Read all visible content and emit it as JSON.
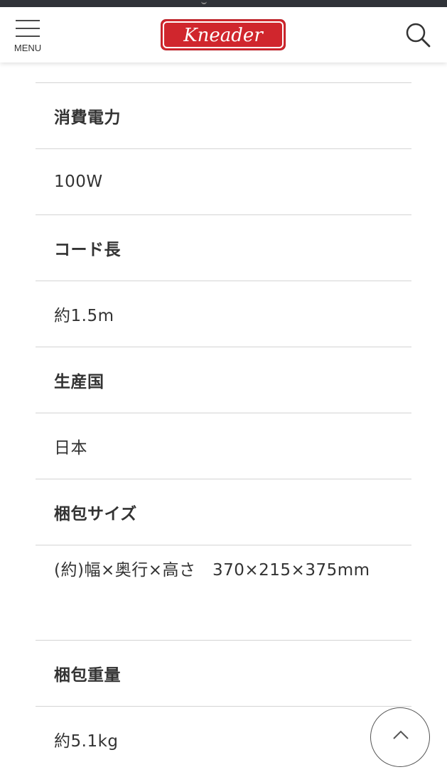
{
  "header": {
    "menu_label": "MENU",
    "logo_text": "Kneader",
    "brand_color": "#d0262d",
    "icons": {
      "menu": "hamburger-icon",
      "search": "search-icon"
    }
  },
  "specs": [
    {
      "label": "消費電力",
      "value": "100W"
    },
    {
      "label": "コード長",
      "value": "約1.5m"
    },
    {
      "label": "生産国",
      "value": "日本"
    },
    {
      "label": "梱包サイズ",
      "value": "(約)幅×奥行×高さ　370×215×375mm"
    },
    {
      "label": "梱包重量",
      "value": "約5.1kg"
    }
  ],
  "scroll_top": {
    "icon": "chevron-up-icon"
  }
}
